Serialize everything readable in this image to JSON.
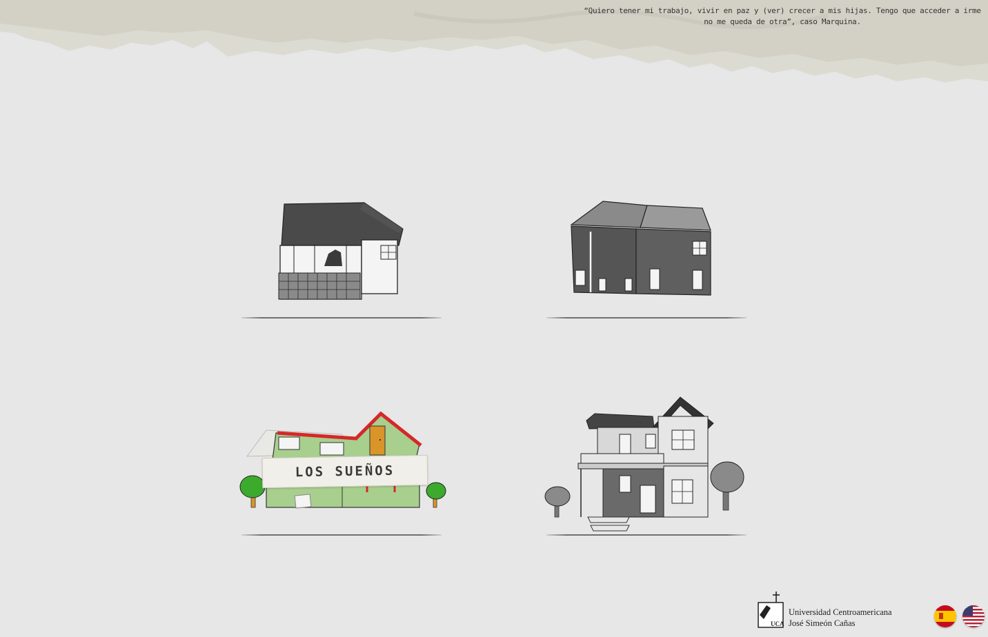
{
  "header": {
    "quote": "“Quiero tener mi trabajo, vivir en paz y (ver) crecer a mis hijas. Tengo que acceder a irme no me queda de otra”, caso Marquina."
  },
  "houses": [
    {
      "id": "house-1",
      "label": ""
    },
    {
      "id": "house-2",
      "label": ""
    },
    {
      "id": "house-3",
      "label": "LOS SUEÑOS"
    },
    {
      "id": "house-4",
      "label": ""
    }
  ],
  "footer": {
    "logo_mark": "UCA",
    "logo_line1": "Universidad Centroamericana",
    "logo_line2": "José Simeón Cañas"
  },
  "languages": [
    {
      "code": "es",
      "icon": "spain-flag-icon"
    },
    {
      "code": "en",
      "icon": "us-flag-icon"
    }
  ],
  "colors": {
    "background": "#e7e7e7",
    "paper": "#dcdad0",
    "roof_red": "#d62828",
    "house_green": "#a8cf8e",
    "tree_green": "#3caa2c",
    "door_orange": "#d9942a"
  }
}
